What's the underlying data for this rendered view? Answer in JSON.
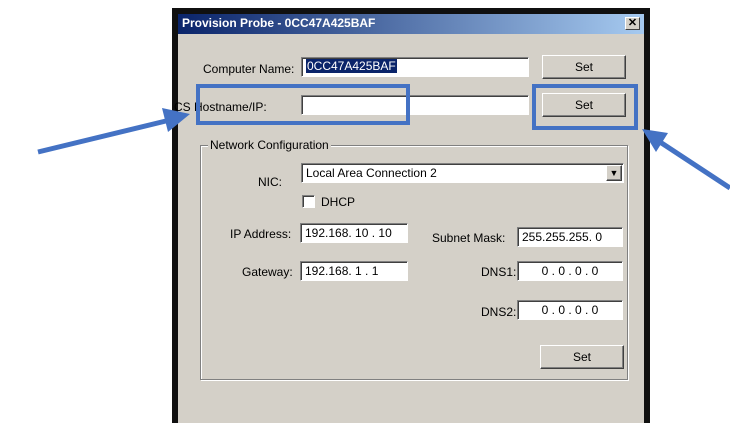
{
  "window": {
    "title": "Provision Probe - 0CC47A425BAF",
    "close_glyph": "✕"
  },
  "computer_name": {
    "label": "Computer Name:",
    "value": "0CC47A425BAF",
    "set_label": "Set"
  },
  "cs_hostname": {
    "label": "CS Hostname/IP:",
    "value": "",
    "set_label": "Set"
  },
  "network": {
    "group_label": "Network Configuration",
    "nic_label": "NIC:",
    "nic_value": "Local Area Connection 2",
    "dhcp_label": "DHCP",
    "dhcp_checked": false,
    "ip_label": "IP Address:",
    "ip_value": "192.168. 10 . 10",
    "subnet_label": "Subnet Mask:",
    "subnet_value": "255.255.255.  0",
    "gateway_label": "Gateway:",
    "gateway_value": "192.168.  1  .  1",
    "dns1_label": "DNS1:",
    "dns1_value": "0  .  0  .  0  .  0",
    "dns2_label": "DNS2:",
    "dns2_value": "0  .  0  .  0  .  0",
    "set_label": "Set"
  },
  "annotation_color": "#4472c4"
}
